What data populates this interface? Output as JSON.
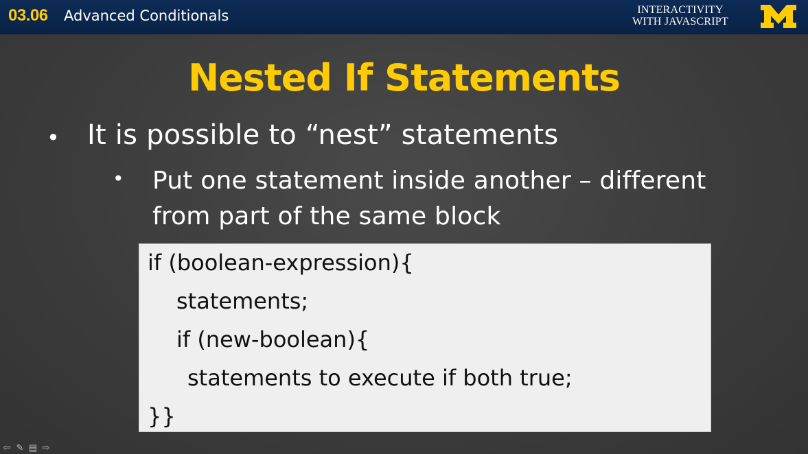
{
  "header": {
    "lesson_number": "03.06",
    "lesson_title": "Advanced Conditionals",
    "course_line1": "INTERACTIVITY",
    "course_line2": "WITH JAVASCRIPT",
    "logo": "block-m-logo",
    "accent_color": "#ffcb05",
    "bar_color": "#0d2b55"
  },
  "slide": {
    "title": "Nested If Statements",
    "bullet1": "It is possible to “nest” statements",
    "bullet2": "Put one statement inside another – different from part of the same block"
  },
  "code": {
    "line1": "if (boolean-expression){",
    "line2": "statements;",
    "line3": "if (new-boolean){",
    "line4": "statements to execute if both true;",
    "line5": "}}"
  },
  "controls": {
    "icons": [
      "arrow-left-icon",
      "pen-icon",
      "menu-icon",
      "arrow-right-icon"
    ]
  }
}
